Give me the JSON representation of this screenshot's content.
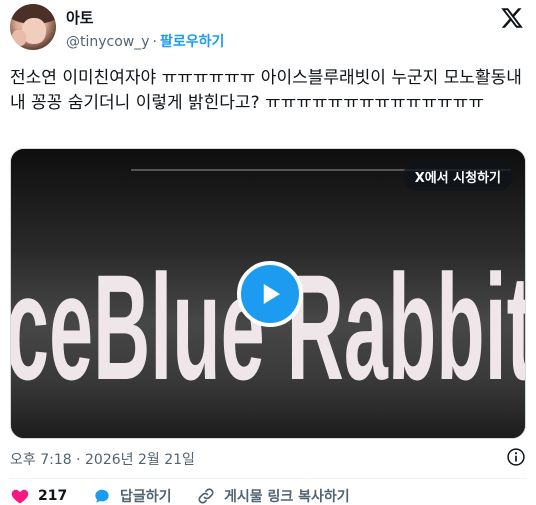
{
  "author": {
    "name": "아토",
    "handle": "@tinycow_y",
    "separator": "·",
    "follow_label": "팔로우하기"
  },
  "tweet": {
    "text": "전소연 이미친여자야 ㅠㅠㅠㅠㅠㅠ 아이스블루래빗이 누군지 모노활동내내 꽁꽁 숨기더니 이렇게 밝힌다고? ㅠㅠㅠㅠㅠㅠㅠㅠㅠㅠㅠㅠㅠㅠ"
  },
  "media": {
    "watch_on_x_label": "X에서 시청하기",
    "stage_text": "ceBlue Rabbit"
  },
  "timestamp": "오후 7:18 · 2026년 2월 21일",
  "actions": {
    "like_count": "217",
    "reply_label": "답글하기",
    "copy_link_label": "게시물 링크 복사하기"
  },
  "colors": {
    "accent": "#1d9bf0",
    "like": "#f91880",
    "secondary_text": "#536471"
  },
  "icons": {
    "logo": "x-logo-icon",
    "play": "play-icon",
    "info": "info-icon",
    "like": "heart-icon",
    "reply": "reply-bubble-icon",
    "copy": "link-icon"
  }
}
